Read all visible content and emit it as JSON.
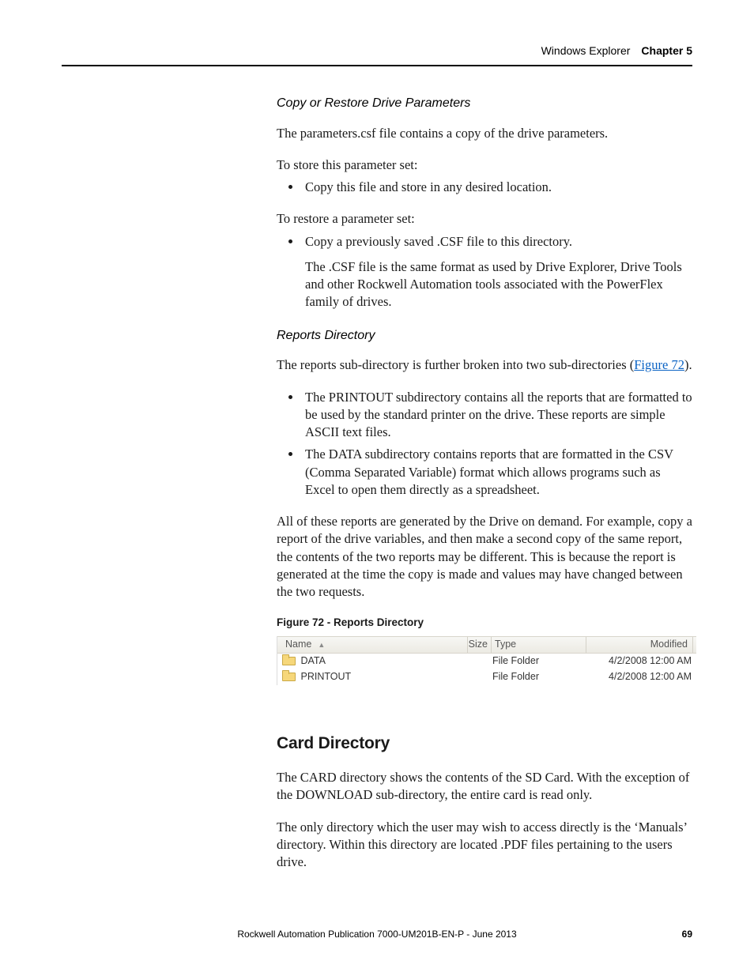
{
  "header": {
    "section_title": "Windows Explorer",
    "chapter_label": "Chapter 5"
  },
  "sections": {
    "copy_restore": {
      "heading": "Copy or Restore Drive Parameters",
      "intro": "The parameters.csf file contains a copy of the drive parameters.",
      "store_leadin": "To store this parameter set:",
      "store_bullet": "Copy this file and store in any desired location.",
      "restore_leadin": "To restore a parameter set:",
      "restore_bullet": "Copy a previously saved .CSF file to this directory.",
      "restore_note": "The .CSF file is the same format as used by Drive Explorer, Drive Tools and other Rockwell Automation tools associated with the PowerFlex family of drives."
    },
    "reports_dir": {
      "heading": "Reports Directory",
      "intro_pre": "The reports sub-directory is further broken into two sub-directories (",
      "intro_link": "Figure 72",
      "intro_post": ").",
      "bullets": [
        "The PRINTOUT subdirectory contains all the reports that are formatted to be used by the standard printer on the drive. These reports are simple ASCII text files.",
        "The DATA subdirectory contains reports that are formatted in the CSV (Comma Separated Variable) format which allows programs such as Excel to open them directly as a spreadsheet."
      ],
      "closing": "All of these reports are generated by the Drive on demand. For example, copy a report of the drive variables, and then make a second copy of the same report, the contents of the two reports may be different. This is because the report is generated at the time the copy is made and values may have changed between the two requests."
    },
    "figure72": {
      "caption": "Figure 72 - Reports Directory",
      "columns": {
        "name": "Name",
        "size": "Size",
        "type": "Type",
        "modified": "Modified"
      },
      "rows": [
        {
          "name": "DATA",
          "size": "",
          "type": "File Folder",
          "modified": "4/2/2008 12:00 AM"
        },
        {
          "name": "PRINTOUT",
          "size": "",
          "type": "File Folder",
          "modified": "4/2/2008 12:00 AM"
        }
      ]
    },
    "card_dir": {
      "heading": "Card Directory",
      "p1": "The CARD directory shows the contents of the SD Card. With the exception of the DOWNLOAD sub-directory, the entire card is read only.",
      "p2": "The only directory which the user may wish to access directly is the ‘Manuals’ directory. Within this directory are located .PDF files pertaining to the users drive."
    }
  },
  "footer": {
    "publication": "Rockwell Automation Publication 7000-UM201B-EN-P - June 2013",
    "page_number": "69"
  }
}
